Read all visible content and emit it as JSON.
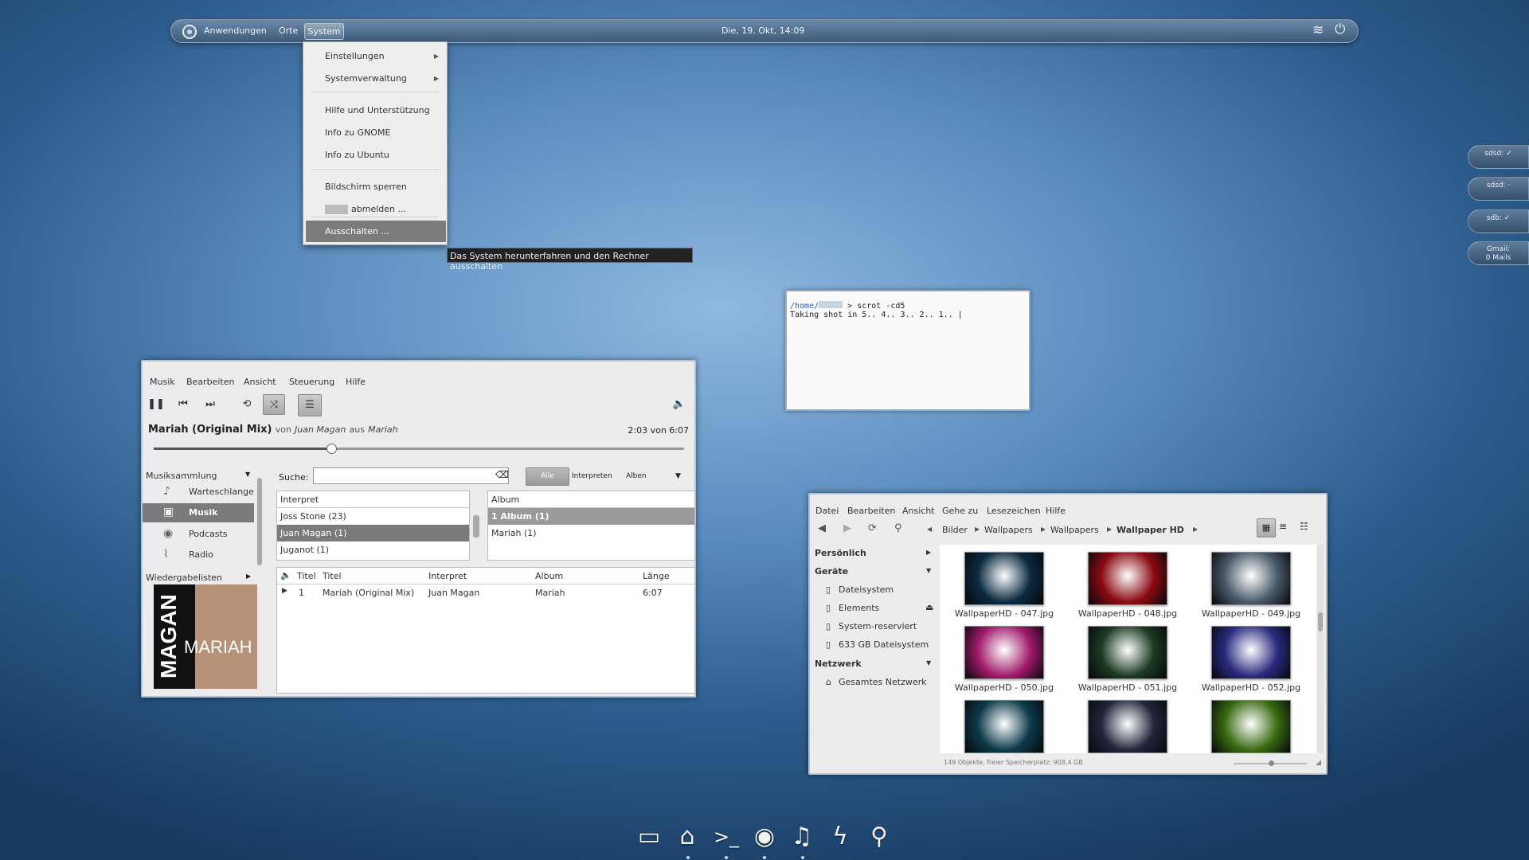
{
  "top_panel": {
    "applications": "Anwendungen",
    "places": "Orte",
    "system": "System",
    "datetime": "Die, 19. Okt, 14:09"
  },
  "system_menu": {
    "items": [
      "Einstellungen",
      "Systemverwaltung",
      "Hilfe und Unterstützung",
      "Info zu GNOME",
      "Info zu Ubuntu",
      "Bildschirm sperren",
      "abmelden ...",
      "Ausschalten ..."
    ],
    "tooltip": "Das System herunterfahren und den Rechner ausschalten"
  },
  "widgets": [
    "sdsd:",
    "sdsd:",
    "sdb:",
    "Gmail:",
    "0 Mails"
  ],
  "terminal": {
    "path": "/home/",
    "prompt": " > ",
    "command": "scrot -cd5",
    "output": "Taking shot in 5.. 4.. 3.. 2.. 1.. |"
  },
  "player": {
    "menu": [
      "Musik",
      "Bearbeiten",
      "Ansicht",
      "Steuerung",
      "Hilfe"
    ],
    "now_title": "Mariah (Original Mix)",
    "now_by": "von",
    "now_artist": "Juan Magan",
    "now_from": "aus",
    "now_album": "Mariah",
    "time": "2:03 von 6:07",
    "progress": 0.335,
    "sidebar_header": "Musiksammlung",
    "sidebar": [
      "Warteschlange",
      "Musik",
      "Podcasts",
      "Radio"
    ],
    "playlists_header": "Wiedergabelisten",
    "cover_big": "MAGAN",
    "cover_name": "MARIAH",
    "search_label": "Suche:",
    "search_value": "",
    "filters": [
      "Alle",
      "Interpreten",
      "Alben"
    ],
    "artist_header": "Interpret",
    "artists": [
      "Joss Stone (23)",
      "Juan Magan (1)",
      "Juganot (1)"
    ],
    "album_header": "Album",
    "albums": [
      "1 Album (1)",
      "Mariah (1)"
    ],
    "track_headers": [
      "Titel",
      "Titel",
      "Interpret",
      "Album",
      "Länge"
    ],
    "tracks": [
      {
        "num": "1",
        "title": "Mariah (Original Mix)",
        "artist": "Juan Magan",
        "album": "Mariah",
        "length": "6:07"
      }
    ]
  },
  "files": {
    "menu": [
      "Datei",
      "Bearbeiten",
      "Ansicht",
      "Gehe zu",
      "Lesezeichen",
      "Hilfe"
    ],
    "breadcrumb": [
      "Bilder",
      "Wallpapers",
      "Wallpapers",
      "Wallpaper HD"
    ],
    "side": {
      "personal": "Persönlich",
      "devices": "Geräte",
      "device_items": [
        "Dateisystem",
        "Elements",
        "System-reserviert",
        "633 GB Dateisystem"
      ],
      "network": "Netzwerk",
      "network_items": [
        "Gesamtes Netzwerk"
      ]
    },
    "thumbs": [
      {
        "label": "WallpaperHD - 047.jpg",
        "color": "#0c2a40"
      },
      {
        "label": "WallpaperHD - 048.jpg",
        "color": "#8a0a12"
      },
      {
        "label": "WallpaperHD - 049.jpg",
        "color": "#4a5a6a"
      },
      {
        "label": "WallpaperHD - 050.jpg",
        "color": "#a01a6a"
      },
      {
        "label": "WallpaperHD - 051.jpg",
        "color": "#1b3a22"
      },
      {
        "label": "WallpaperHD - 052.jpg",
        "color": "#2a2a80"
      },
      {
        "label": "",
        "color": "#0d3a4a"
      },
      {
        "label": "",
        "color": "#22263a"
      },
      {
        "label": "",
        "color": "#3a6a10"
      }
    ],
    "status": "149 Objekte, freier Speicherplatz: 908,4 GB"
  },
  "dock": [
    "computer-icon",
    "home-folder-icon",
    "terminal-icon",
    "firefox-icon",
    "music-icon",
    "lightning-icon",
    "search-icon"
  ]
}
